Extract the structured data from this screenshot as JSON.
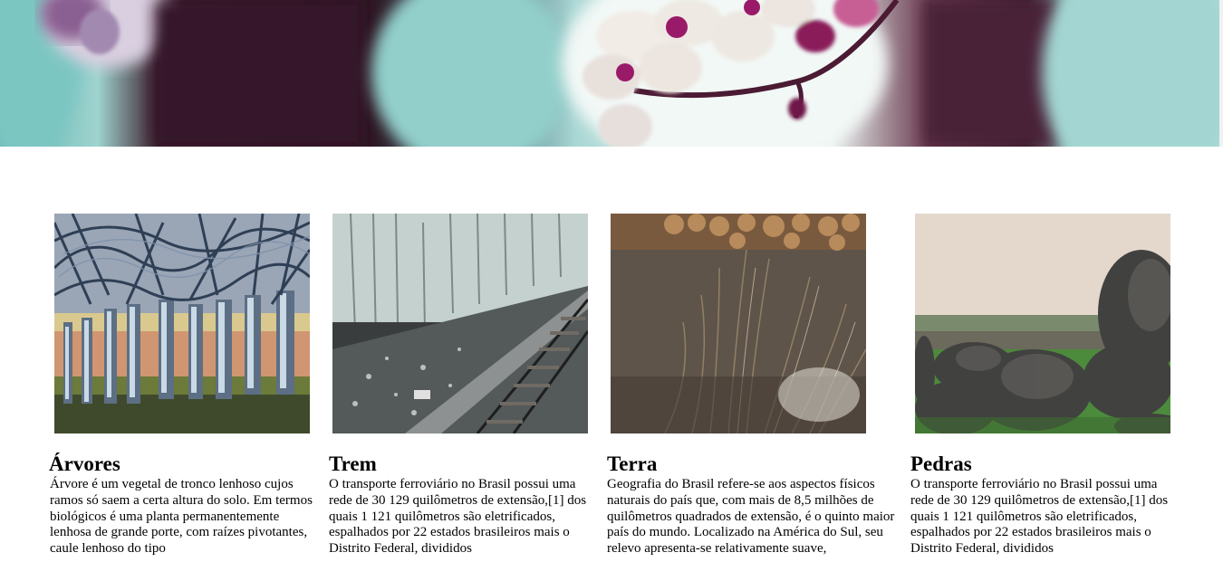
{
  "hero": {
    "image": "cherry-blossom-photo"
  },
  "cards": [
    {
      "title": "Árvores",
      "image": "trees-photo",
      "text": "Árvore é um vegetal de tronco lenhoso cujos ramos só saem a certa altura do solo. Em termos biológicos é uma planta permanentemente lenhosa de grande porte, com raízes pivotantes, caule lenhoso do tipo"
    },
    {
      "title": "Trem",
      "image": "railway-photo",
      "text": "O transporte ferroviário no Brasil possui uma rede de 30 129 quilômetros de extensão,[1] dos quais 1 121 quilômetros são eletrificados, espalhados por 22 estados brasileiros mais o Distrito Federal, divididos"
    },
    {
      "title": "Terra",
      "image": "dry-grass-logs-photo",
      "text": "Geografia do Brasil refere-se aos aspectos físicos naturais do país que, com mais de 8,5 milhões de quilômetros quadrados de extensão, é o quinto maior país do mundo. Localizado na América do Sul, seu relevo apresenta-se relativamente suave,"
    },
    {
      "title": "Pedras",
      "image": "rocks-photo",
      "text": "O transporte ferroviário no Brasil possui uma rede de 30 129 quilômetros de extensão,[1] dos quais 1 121 quilômetros são eletrificados, espalhados por 22 estados brasileiros mais o Distrito Federal, divididos"
    }
  ]
}
